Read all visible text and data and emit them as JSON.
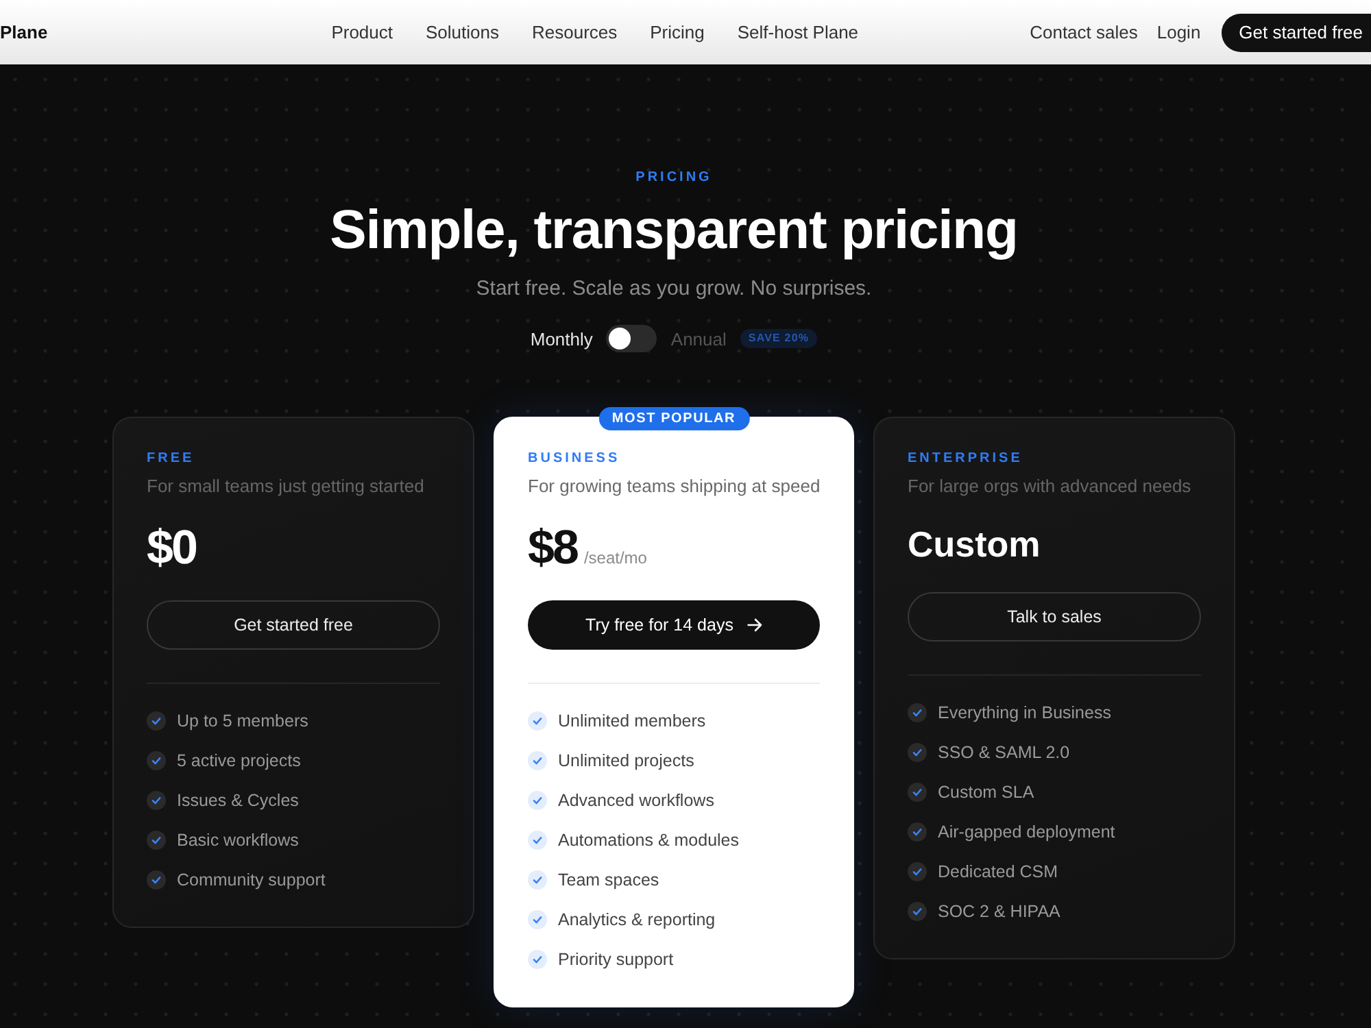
{
  "nav": {
    "logo": "Plane",
    "links": [
      "Product",
      "Solutions",
      "Resources",
      "Pricing",
      "Self-host Plane"
    ],
    "contact": "Contact sales",
    "login": "Login",
    "cta": "Get started free"
  },
  "hero": {
    "eyebrow": "PRICING",
    "title": "Simple, transparent pricing",
    "subtitle": "Start free. Scale as you grow. No surprises."
  },
  "billing": {
    "monthly_label": "Monthly",
    "annual_label": "Annual",
    "annual": false,
    "badge": "SAVE 20%"
  },
  "plans": [
    {
      "tier": "FREE",
      "description": "For small teams just getting started",
      "featured": false,
      "price": {
        "kind": "amount",
        "text": "$0"
      },
      "button": {
        "kind": "outline",
        "label": "Get started free"
      },
      "features": [
        "Up to 5 members",
        "5 active projects",
        "Issues & Cycles",
        "Basic workflows",
        "Community support"
      ]
    },
    {
      "badge": "MOST POPULAR",
      "tier": "BUSINESS",
      "description": "For growing teams shipping at speed",
      "featured": true,
      "price": {
        "kind": "amount",
        "text": "$8",
        "unit": "/seat/mo"
      },
      "button": {
        "kind": "primary",
        "label": "Try free for 14 days"
      },
      "features": [
        "Unlimited members",
        "Unlimited projects",
        "Advanced workflows",
        "Automations & modules",
        "Team spaces",
        "Analytics & reporting",
        "Priority support"
      ]
    },
    {
      "tier": "ENTERPRISE",
      "description": "For large orgs with advanced needs",
      "featured": false,
      "price": {
        "kind": "quote",
        "text": "Custom"
      },
      "button": {
        "kind": "outline",
        "label": "Talk to sales"
      },
      "features": [
        "Everything in Business",
        "SSO & SAML 2.0",
        "Custom SLA",
        "Air-gapped deployment",
        "Dedicated CSM",
        "SOC 2 & HIPAA"
      ]
    }
  ]
}
